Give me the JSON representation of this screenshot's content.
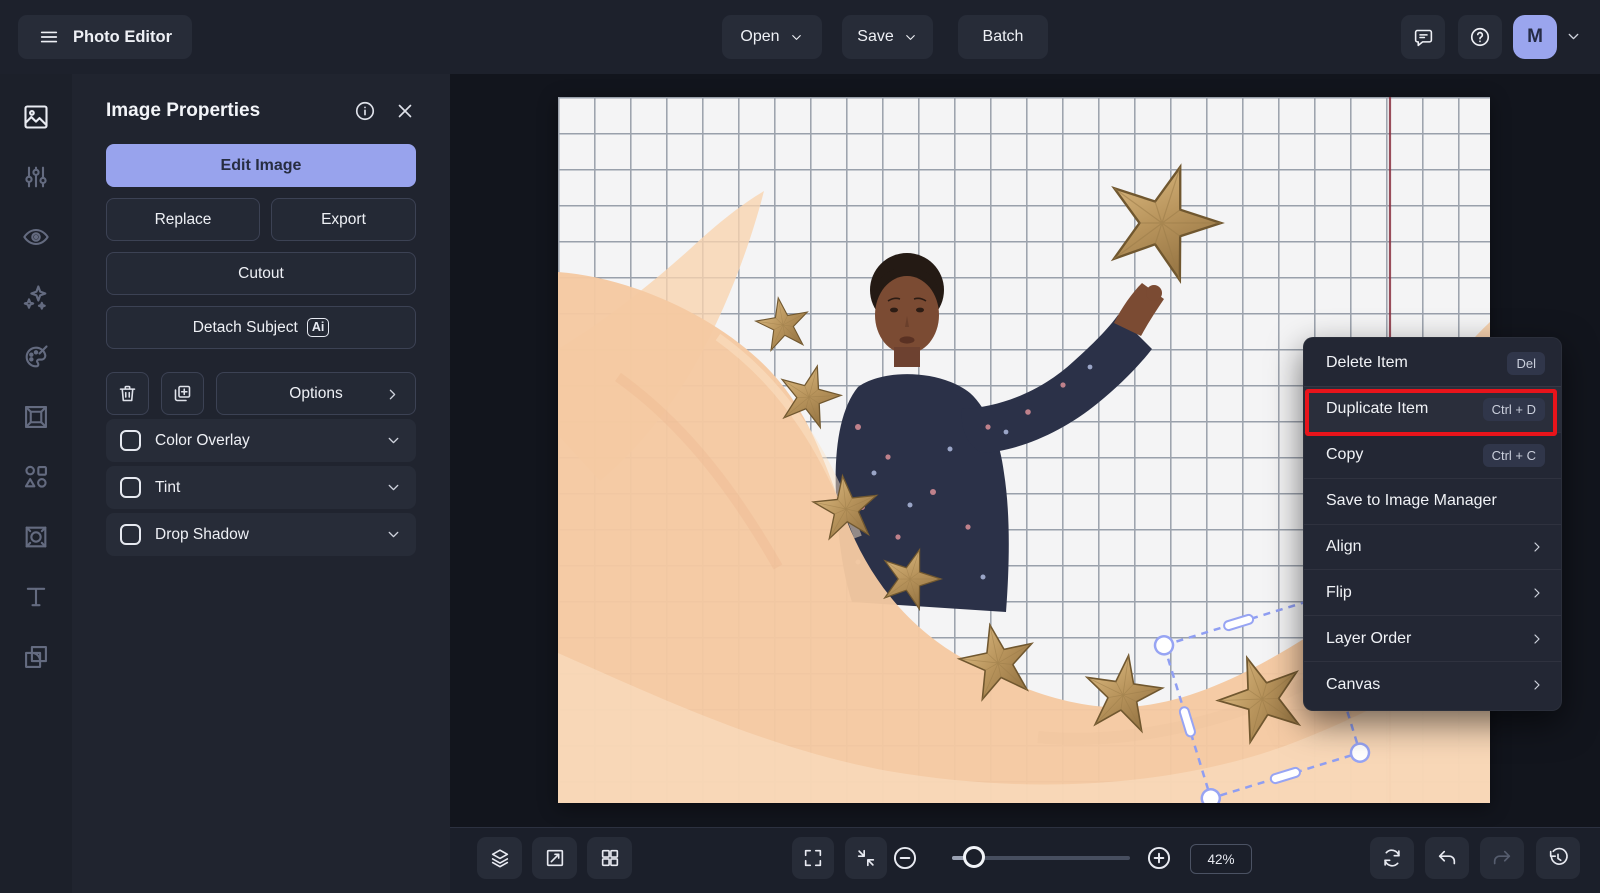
{
  "topbar": {
    "app_title": "Photo Editor",
    "open_label": "Open",
    "save_label": "Save",
    "batch_label": "Batch",
    "avatar_initial": "M"
  },
  "sidebar": {
    "items": [
      "image",
      "adjustments",
      "eye",
      "ai-effects",
      "palette",
      "frame",
      "shapes",
      "border-pattern",
      "text",
      "overlap-layers"
    ],
    "active_item": "image"
  },
  "panel": {
    "title": "Image Properties",
    "edit_image_label": "Edit Image",
    "replace_label": "Replace",
    "export_label": "Export",
    "cutout_label": "Cutout",
    "detach_subject_label": "Detach Subject",
    "detach_subject_badge": "Ai",
    "options_label": "Options",
    "toggles": [
      {
        "label": "Color Overlay",
        "checked": false
      },
      {
        "label": "Tint",
        "checked": false
      },
      {
        "label": "Drop Shadow",
        "checked": false
      }
    ]
  },
  "context_menu": {
    "items": [
      {
        "label": "Delete Item",
        "shortcut": "Del"
      },
      {
        "label": "Duplicate Item",
        "shortcut": "Ctrl + D",
        "highlighted": true
      },
      {
        "label": "Copy",
        "shortcut": "Ctrl + C"
      },
      {
        "label": "Save to Image Manager"
      },
      {
        "label": "Align",
        "submenu": true
      },
      {
        "label": "Flip",
        "submenu": true
      },
      {
        "label": "Layer Order",
        "submenu": true
      },
      {
        "label": "Canvas",
        "submenu": true
      }
    ]
  },
  "bottombar": {
    "zoom_value": "42%"
  },
  "colors": {
    "accent": "#98a3ed",
    "annotation_red": "#e8141b",
    "topbar_bg": "#1d212c",
    "menu_bg": "#232734"
  }
}
